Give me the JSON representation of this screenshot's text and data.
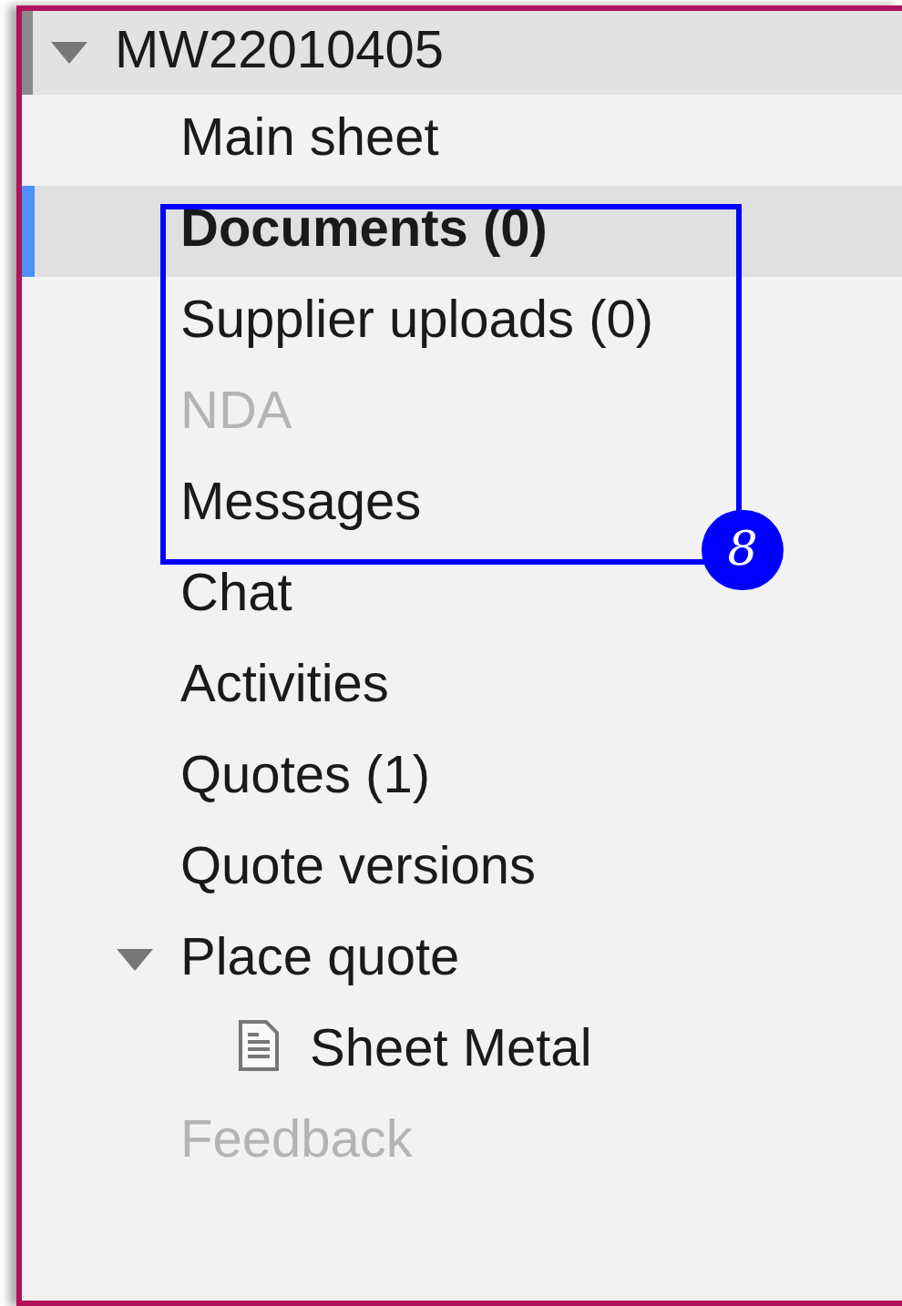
{
  "tree": {
    "label": "MW22010405",
    "expanded": true,
    "selected": false,
    "disabled": false,
    "children": [
      {
        "label": "Main sheet",
        "selected": false,
        "disabled": false
      },
      {
        "label": "Documents (0)",
        "selected": true,
        "disabled": false
      },
      {
        "label": "Supplier uploads (0)",
        "selected": false,
        "disabled": false
      },
      {
        "label": "NDA",
        "selected": false,
        "disabled": true
      },
      {
        "label": "Messages",
        "selected": false,
        "disabled": false
      },
      {
        "label": "Chat",
        "selected": false,
        "disabled": false
      },
      {
        "label": "Activities",
        "selected": false,
        "disabled": false
      },
      {
        "label": "Quotes (1)",
        "selected": false,
        "disabled": false
      },
      {
        "label": "Quote versions",
        "selected": false,
        "disabled": false
      },
      {
        "label": "Place quote",
        "expanded": true,
        "selected": false,
        "disabled": false,
        "children": [
          {
            "label": "Sheet Metal",
            "kind": "document",
            "selected": false,
            "disabled": false
          }
        ]
      },
      {
        "label": "Feedback",
        "selected": false,
        "disabled": true
      }
    ]
  },
  "annotation": {
    "label": "8"
  }
}
